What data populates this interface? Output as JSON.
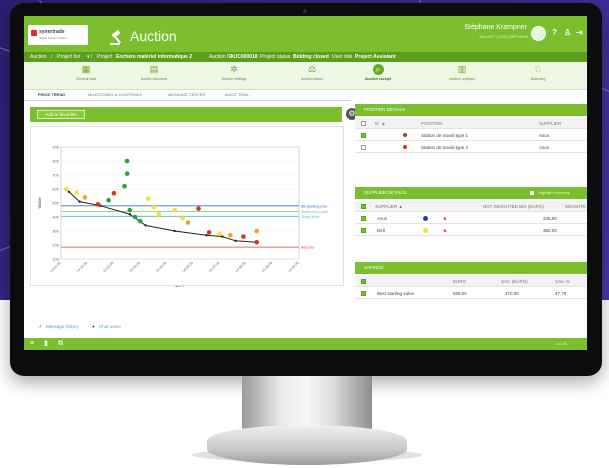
{
  "app": {
    "logo_name": "synertrade",
    "logo_tagline": "digital transformation",
    "title": "Auction"
  },
  "user": {
    "name": "Stéphane Krampner",
    "datetime": "20.6.2017 | 19:36 | GMT+02:00"
  },
  "header_icons": [
    "help-icon",
    "user-icon",
    "logout-icon"
  ],
  "breadcrumb": {
    "parts": [
      "Auction",
      "Project list",
      "Project",
      "Enchère matériel informatique 2",
      "Auction ID",
      "AUC000018",
      "Project status",
      "Bidding closed",
      "User role",
      "Project Assistant"
    ]
  },
  "steps": [
    {
      "label": "General data",
      "icon": "calendar-icon"
    },
    {
      "label": "Auction structure",
      "icon": "document-icon"
    },
    {
      "label": "Auction settings",
      "icon": "gear-icon"
    },
    {
      "label": "Auction status",
      "icon": "scale-icon"
    },
    {
      "label": "Auction cockpit",
      "icon": "search-icon"
    },
    {
      "label": "Auction analysis",
      "icon": "analysis-icon"
    },
    {
      "label": "Awarding",
      "icon": "award-icon"
    }
  ],
  "tabs": [
    "PRICE TREND",
    "MILESTONES & OVERTIMES",
    "MESSAGE CENTER",
    "AUDIT TRAIL"
  ],
  "toolbar": {
    "favorites": "Add to favorites"
  },
  "chart_data": {
    "type": "scatter",
    "title": "",
    "xlabel": "Time",
    "ylabel": "Value",
    "ylim": [
      100,
      900
    ],
    "y_ticks": [
      100,
      200,
      300,
      400,
      500,
      600,
      700,
      800,
      900
    ],
    "x_ticks": [
      "14:31:00",
      "14:32:00",
      "14:33:00",
      "14:34:00",
      "14:35:00",
      "14:36:00",
      "14:37:00",
      "14:38:00",
      "14:39:00",
      "14:40:00"
    ],
    "reference_lines": [
      {
        "name": "Bid grading price",
        "value": 480,
        "color": "#3a6fc4"
      },
      {
        "name": "Reservation price",
        "value": 440,
        "color": "#6fcf4f"
      },
      {
        "name": "Target price",
        "value": 405,
        "color": "#43c8c0"
      },
      {
        "name": "Best bid",
        "value": 185,
        "color": "#e0403a"
      }
    ],
    "best_bid_line": [
      [
        0.3,
        580
      ],
      [
        0.7,
        510
      ],
      [
        1.5,
        480
      ],
      [
        2.6,
        420
      ],
      [
        3.2,
        340
      ],
      [
        4.3,
        300
      ],
      [
        5.5,
        270
      ],
      [
        6.1,
        260
      ],
      [
        6.6,
        230
      ],
      [
        7.4,
        220
      ]
    ],
    "points": [
      {
        "x": 0.2,
        "y": 600,
        "color": "#f3e13a"
      },
      {
        "x": 0.6,
        "y": 575,
        "color": "#f3e13a"
      },
      {
        "x": 0.9,
        "y": 540,
        "color": "#f3a22a"
      },
      {
        "x": 1.4,
        "y": 490,
        "color": "#d8312a"
      },
      {
        "x": 1.8,
        "y": 520,
        "color": "#2e9e3e"
      },
      {
        "x": 2.0,
        "y": 570,
        "color": "#d8312a"
      },
      {
        "x": 2.4,
        "y": 620,
        "color": "#2e9e3e"
      },
      {
        "x": 2.5,
        "y": 800,
        "color": "#2e9e3e"
      },
      {
        "x": 2.5,
        "y": 710,
        "color": "#2e9e3e"
      },
      {
        "x": 2.6,
        "y": 450,
        "color": "#2e9e3e"
      },
      {
        "x": 2.8,
        "y": 400,
        "color": "#2e9e3e"
      },
      {
        "x": 3.0,
        "y": 370,
        "color": "#2e9e3e"
      },
      {
        "x": 3.3,
        "y": 530,
        "color": "#f3e13a"
      },
      {
        "x": 3.5,
        "y": 470,
        "color": "#f3e13a"
      },
      {
        "x": 3.7,
        "y": 420,
        "color": "#f3e13a"
      },
      {
        "x": 4.3,
        "y": 450,
        "color": "#f3e13a"
      },
      {
        "x": 4.6,
        "y": 390,
        "color": "#f3e13a"
      },
      {
        "x": 4.8,
        "y": 360,
        "color": "#f3a22a"
      },
      {
        "x": 5.2,
        "y": 460,
        "color": "#d8312a"
      },
      {
        "x": 5.6,
        "y": 290,
        "color": "#d8312a"
      },
      {
        "x": 6.0,
        "y": 280,
        "color": "#f3e13a"
      },
      {
        "x": 6.4,
        "y": 270,
        "color": "#f3a22a"
      },
      {
        "x": 6.9,
        "y": 260,
        "color": "#d8312a"
      },
      {
        "x": 7.4,
        "y": 300,
        "color": "#f3a22a"
      },
      {
        "x": 7.4,
        "y": 220,
        "color": "#d8312a"
      }
    ],
    "grid": true
  },
  "panels": {
    "position": {
      "title": "POSITION DETAILS",
      "columns": [
        "N° ▲",
        "POSITION",
        "SUPPLIER"
      ],
      "rows": [
        {
          "num": "",
          "position": "Station de travail type 1",
          "supplier": "Asus"
        },
        {
          "num": "",
          "position": "Station de travail type 2",
          "supplier": "Asus"
        }
      ]
    },
    "supplier": {
      "title": "SUPPLIER DETAILS",
      "toggle": "Highlight currency",
      "columns": [
        "SUPPLIER ▲",
        "NOT WEIGHTED BID (EURO)",
        "WEIGHTE"
      ],
      "rows": [
        {
          "name": "Asus",
          "bid": "235,00"
        },
        {
          "name": "Dell",
          "bid": "380,00"
        }
      ]
    },
    "savings": {
      "title": "SAVINGS",
      "columns": [
        "EURO",
        "SAV. (EURO)",
        "SAV. %"
      ],
      "rows": [
        {
          "label": "Best starting value",
          "euro": "565,00",
          "sav": "270,00",
          "pct": "47,79"
        }
      ]
    }
  },
  "footer": {
    "history": "Message history",
    "chat": "Chat users"
  },
  "version": "4.0.00",
  "colors": {
    "brand": "#7bbf2e",
    "brand_dark": "#5a9e1e",
    "bg": "#3b2a8f"
  }
}
